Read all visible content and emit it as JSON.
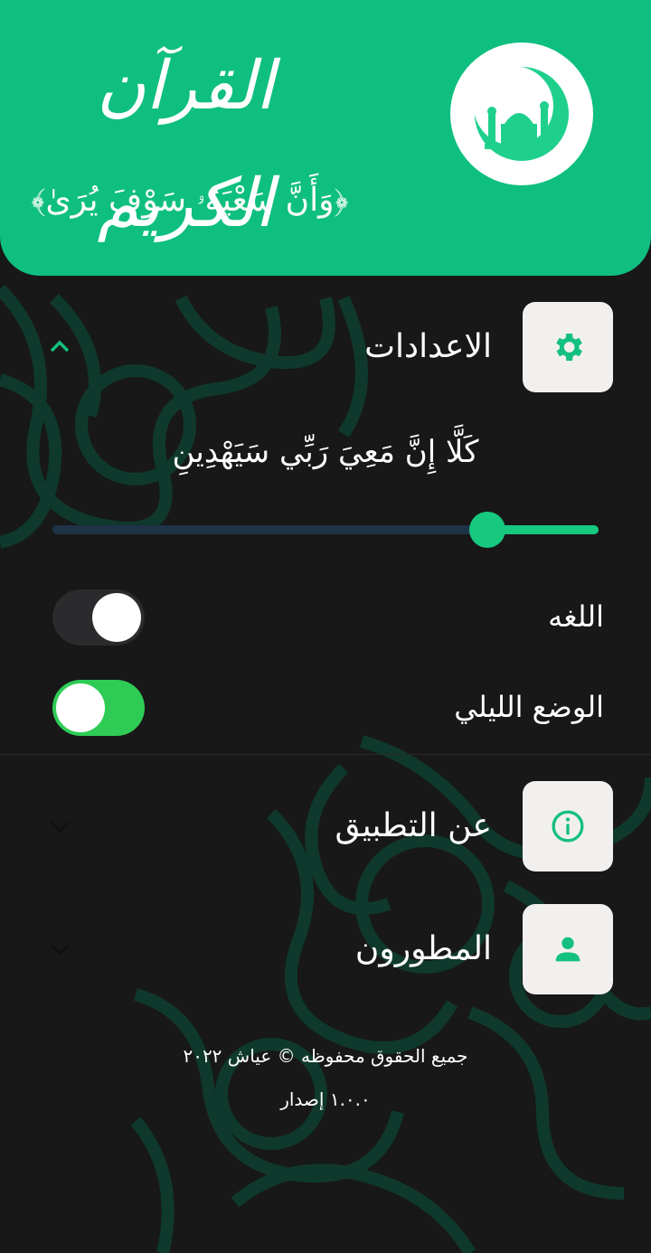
{
  "header": {
    "app_title": "القرآن الكريم",
    "verse": "﴿وَأَنَّ سَعْيَهُۥ سَوْفَ يُرَىٰ﴾"
  },
  "settings": {
    "label": "الاعدادات",
    "expanded": true,
    "verse_sample": "كَلَّا إِنَّ مَعِيَ رَبِّي سَيَهْدِينِ",
    "font_size_slider_fraction": 0.17,
    "language": {
      "label": "اللغه",
      "on": false
    },
    "night_mode": {
      "label": "الوضع الليلي",
      "on": true
    }
  },
  "about": {
    "label": "عن التطبيق"
  },
  "developers": {
    "label": "المطورون"
  },
  "footer": {
    "copyright": "جميع الحقوق محفوظه © عياش ٢٠٢٢",
    "version": "١.٠.٠ إصدار"
  },
  "colors": {
    "accent": "#0fbf7f",
    "background": "#181818",
    "ornament": "#0f3b2e",
    "tile": "#f2f0ef"
  },
  "icons": {
    "logo": "mosque-crescent-icon",
    "settings": "gear-icon",
    "about": "info-icon",
    "developers": "person-icon",
    "collapse": "chevron-up-icon",
    "expand": "chevron-down-icon"
  }
}
